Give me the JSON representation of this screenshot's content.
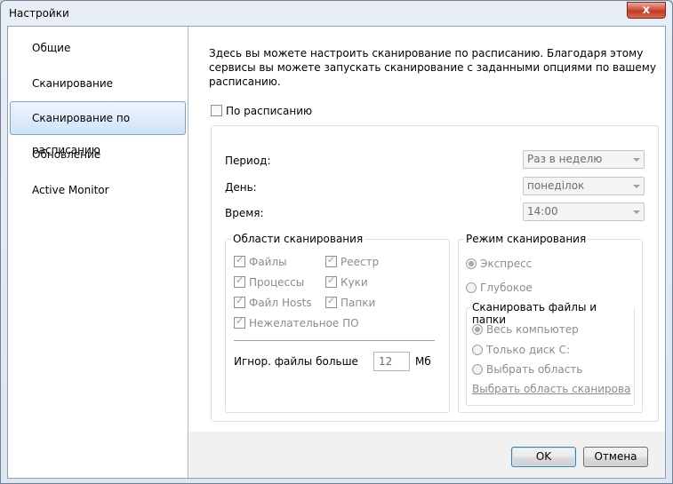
{
  "window": {
    "title": "Настройки",
    "close_label": "x"
  },
  "sidebar": {
    "items": [
      {
        "label": "Общие",
        "selected": false
      },
      {
        "label": "Сканирование",
        "selected": false
      },
      {
        "label": "Сканирование по расписанию",
        "selected": true
      },
      {
        "label": "Обновление",
        "selected": false
      },
      {
        "label": "Active Monitor",
        "selected": false
      }
    ]
  },
  "main": {
    "description": "Здесь вы можете настроить сканирование по расписанию. Благодаря этому сервисы вы можете запускать сканирование с заданными опциями по вашему расписанию.",
    "schedule_checkbox": {
      "label": "По расписанию",
      "checked": false
    },
    "period": {
      "label": "Период:",
      "value": "Раз в неделю"
    },
    "day": {
      "label": "День:",
      "value": "понеділок"
    },
    "time": {
      "label": "Время:",
      "value": "14:00"
    },
    "scan_areas": {
      "legend": "Области сканирования",
      "items": [
        {
          "label": "Файлы",
          "checked": true
        },
        {
          "label": "Реестр",
          "checked": true
        },
        {
          "label": "Процессы",
          "checked": true
        },
        {
          "label": "Куки",
          "checked": true
        },
        {
          "label": "Файл Hosts",
          "checked": true
        },
        {
          "label": "Папки",
          "checked": true
        },
        {
          "label": "Нежелательное ПО",
          "checked": true
        }
      ],
      "ignore_label": "Игнор. файлы больше",
      "ignore_value": "12",
      "ignore_unit": "Мб"
    },
    "scan_mode": {
      "legend": "Режим сканирования",
      "options": [
        {
          "label": "Экспресс",
          "selected": true
        },
        {
          "label": "Глубокое",
          "selected": false
        }
      ],
      "scan_files": {
        "legend": "Сканировать файлы и папки",
        "options": [
          {
            "label": "Весь компьютер",
            "selected": true
          },
          {
            "label": "Только диск С:",
            "selected": false
          },
          {
            "label": "Выбрать область",
            "selected": false
          }
        ],
        "link": "Выбрать область сканирова"
      }
    }
  },
  "footer": {
    "ok_label": "OK",
    "cancel_label": "Отмена"
  }
}
